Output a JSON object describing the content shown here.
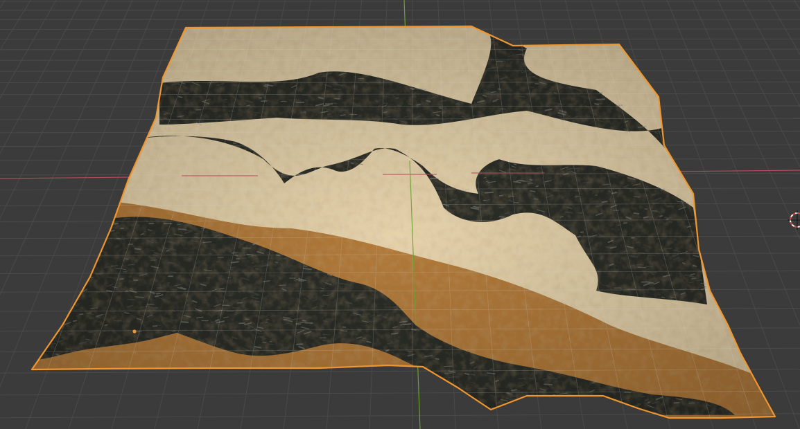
{
  "viewport": {
    "background": "#3b3b3b",
    "grid_color": "#4a4a4a",
    "grid_minor_color": "#444444"
  },
  "axes": {
    "x_axis_color": "#b54a57",
    "y_axis_color": "#6aa22c"
  },
  "selection": {
    "outline_color": "#f0962e",
    "origin_color": "#f0962e"
  },
  "terrain": {
    "sand_light": "#e6d3ac",
    "sand_dark": "#b27a3a",
    "rock_dark": "#2b2d27",
    "rock_mid": "#5a5c55",
    "rock_light": "#9a9c95"
  },
  "cursor_3d": {
    "ring_color_a": "#e04040",
    "ring_color_b": "#ffffff"
  }
}
